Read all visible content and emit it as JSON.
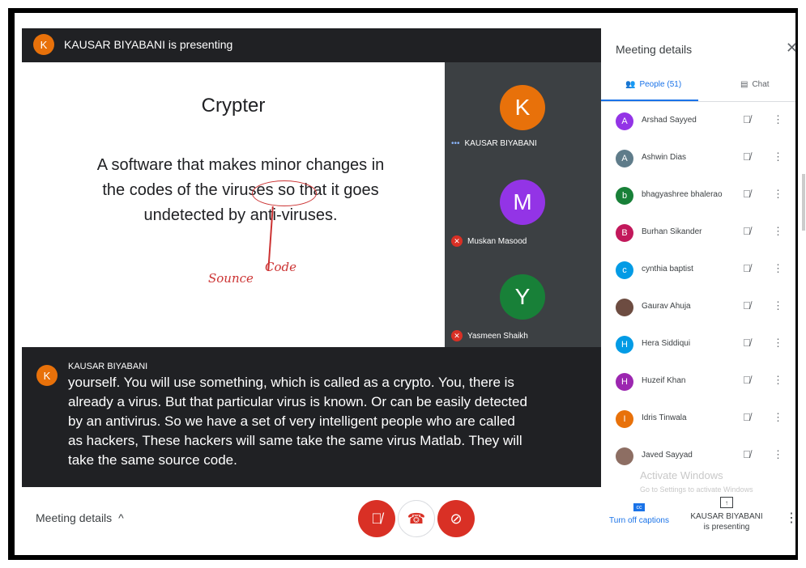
{
  "presenting_bar": {
    "avatar_letter": "K",
    "text": "KAUSAR BIYABANI is presenting"
  },
  "slide": {
    "title": "Crypter",
    "body": "A software that makes minor changes in the codes of the viruses so that it goes undetected by anti-viruses.",
    "ink_word1": "Sounce",
    "ink_word2": "Code"
  },
  "tiles": [
    {
      "letter": "K",
      "color": "#e8710a",
      "name": "KAUSAR BIYABANI",
      "muted": false,
      "prefix": "•••"
    },
    {
      "letter": "M",
      "color": "#9334e6",
      "name": "Muskan Masood",
      "muted": true
    },
    {
      "letter": "Y",
      "color": "#188038",
      "name": "Yasmeen Shaikh",
      "muted": true
    }
  ],
  "caption": {
    "avatar_letter": "K",
    "speaker": "KAUSAR BIYABANI",
    "text": "yourself. You will use something, which is called as a crypto. You, there is already a virus. But that particular virus is known. Or can be easily detected by an antivirus. So we have a set of very intelligent people who are called as hackers, These hackers will same take the same virus Matlab. They will take the same source code."
  },
  "bottom": {
    "meeting_details": "Meeting details",
    "turn_off_captions": "Turn off captions",
    "presenting_line1": "KAUSAR BIYABANI",
    "presenting_line2": "is presenting"
  },
  "panel": {
    "title": "Meeting details",
    "tab_people": "People (51)",
    "tab_chat": "Chat",
    "people": [
      {
        "letter": "A",
        "color": "#9334e6",
        "name": "Arshad Sayyed"
      },
      {
        "letter": "A",
        "color": "#5f7c8a",
        "name": "Ashwin Dias"
      },
      {
        "letter": "b",
        "color": "#188038",
        "name": "bhagyashree bhalerao"
      },
      {
        "letter": "B",
        "color": "#c2185b",
        "name": "Burhan Sikander"
      },
      {
        "letter": "c",
        "color": "#039be5",
        "name": "cynthia baptist"
      },
      {
        "letter": "",
        "color": "#6d4c41",
        "name": "Gaurav Ahuja"
      },
      {
        "letter": "H",
        "color": "#039be5",
        "name": "Hera Siddiqui"
      },
      {
        "letter": "H",
        "color": "#9c27b0",
        "name": "Huzeif Khan"
      },
      {
        "letter": "I",
        "color": "#e8710a",
        "name": "Idris Tinwala"
      },
      {
        "letter": "",
        "color": "#8d6e63",
        "name": "Javed Sayyad"
      }
    ]
  },
  "watermark": {
    "line1": "Activate Windows",
    "line2": "Go to Settings to activate Windows"
  }
}
